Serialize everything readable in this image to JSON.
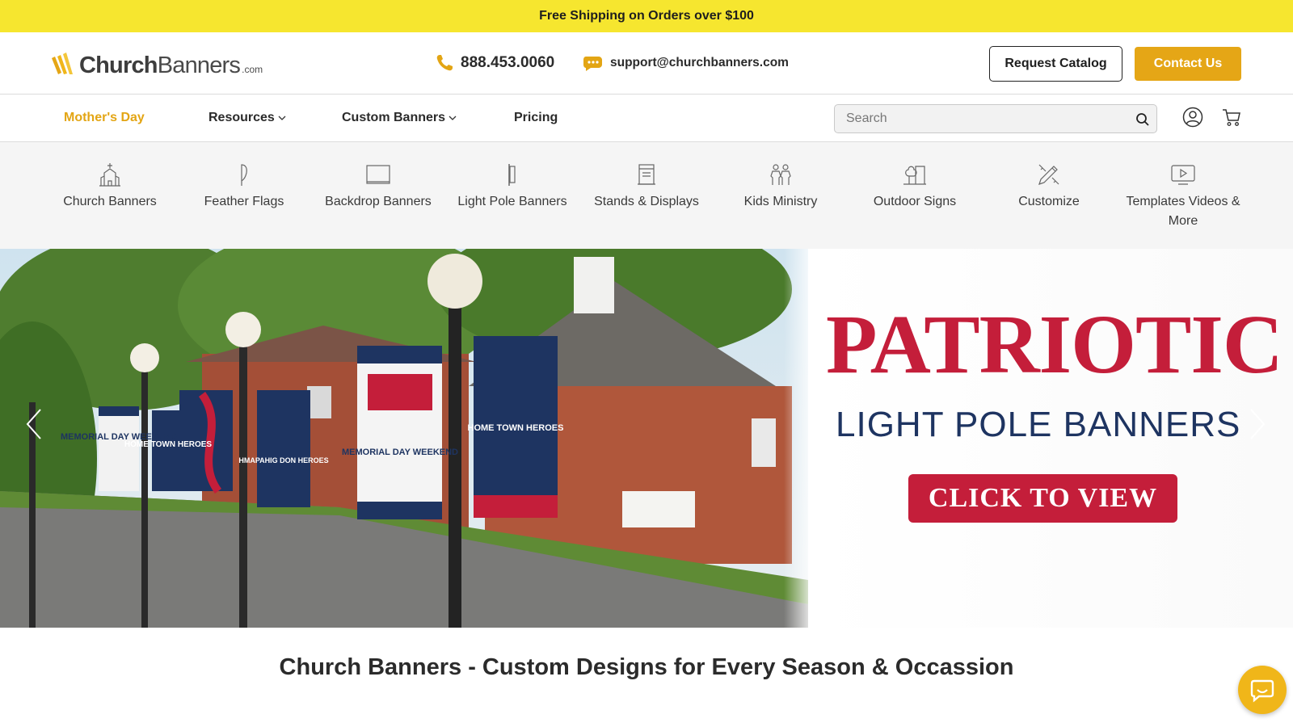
{
  "promo": {
    "text": "Free Shipping on Orders over $100"
  },
  "header": {
    "logo": {
      "brand_bold": "Church",
      "brand_rest": "Banners",
      "suffix": ".com"
    },
    "phone": "888.453.0060",
    "email": "support@churchbanners.com",
    "request_catalog_label": "Request Catalog",
    "contact_label": "Contact Us"
  },
  "nav": {
    "items": [
      {
        "label": "Mother's Day",
        "active": true
      },
      {
        "label": "Resources",
        "has_dropdown": true
      },
      {
        "label": "Custom Banners",
        "has_dropdown": true
      },
      {
        "label": "Pricing"
      }
    ],
    "search": {
      "placeholder": "Search"
    }
  },
  "categories": [
    {
      "label": "Church Banners",
      "icon": "church-icon"
    },
    {
      "label": "Feather Flags",
      "icon": "feather-flag-icon"
    },
    {
      "label": "Backdrop Banners",
      "icon": "backdrop-icon"
    },
    {
      "label": "Light Pole Banners",
      "icon": "light-pole-icon"
    },
    {
      "label": "Stands & Displays",
      "icon": "stand-icon"
    },
    {
      "label": "Kids Ministry",
      "icon": "kids-icon"
    },
    {
      "label": "Outdoor Signs",
      "icon": "outdoor-sign-icon"
    },
    {
      "label": "Customize",
      "icon": "customize-icon"
    },
    {
      "label": "Templates Videos & More",
      "icon": "video-icon"
    }
  ],
  "hero": {
    "title": "PATRIOTIC",
    "subtitle": "LIGHT POLE BANNERS",
    "cta": "CLICK TO VIEW",
    "banners": [
      {
        "text": "MEMORIAL DAY WEEKEND"
      },
      {
        "text": "HOME TOWN HEROES"
      },
      {
        "text": "HMAPAHIG DON HEROES"
      },
      {
        "text": "MEMORIAL DAY WEEKEND"
      },
      {
        "text": "HOME TOWN HEROES"
      }
    ]
  },
  "page_heading": "Church Banners - Custom Designs for Every Season & Occassion",
  "colors": {
    "promo": "#f6e62f",
    "accent": "#e5a616",
    "hero_red": "#c41e3a",
    "hero_navy": "#1e3461"
  }
}
